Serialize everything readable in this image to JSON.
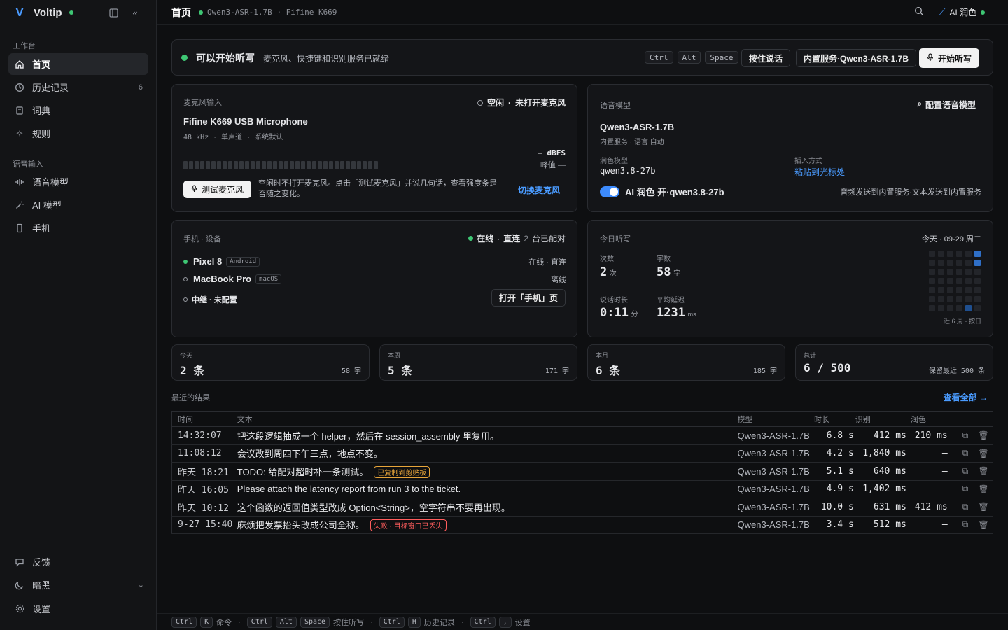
{
  "app": {
    "name": "Voltip",
    "logo": "V"
  },
  "sidebar": {
    "sections": [
      {
        "label": "工作台"
      },
      {
        "label": "语音输入"
      }
    ],
    "items": [
      {
        "label": "首页",
        "icon": "home-icon"
      },
      {
        "label": "历史记录",
        "icon": "history-icon",
        "count": "6"
      },
      {
        "label": "词典",
        "icon": "book-icon"
      },
      {
        "label": "规则",
        "icon": "sparkle-icon"
      },
      {
        "label": "语音模型",
        "icon": "waveform-icon"
      },
      {
        "label": "AI 模型",
        "icon": "wand-icon"
      },
      {
        "label": "手机",
        "icon": "phone-icon"
      }
    ],
    "bottom": [
      {
        "label": "反馈",
        "icon": "feedback-icon"
      },
      {
        "label": "暗黑",
        "icon": "moon-icon"
      },
      {
        "label": "设置",
        "icon": "gear-icon"
      }
    ]
  },
  "topbar": {
    "title": "首页",
    "subtitle": "Qwen3-ASR-1.7B · Fifine K669",
    "ai_label": "AI 润色"
  },
  "ready": {
    "title": "可以开始听写",
    "desc": "麦克风、快捷键和识别服务已就绪",
    "keys": [
      "Ctrl",
      "Alt",
      "Space"
    ],
    "mode_btn": "按住说话",
    "service_btn": "内置服务·Qwen3-ASR-1.7B",
    "start_btn": "开始听写"
  },
  "mic": {
    "label": "麦克风输入",
    "status": "空闲",
    "status2": "未打开麦克风",
    "name": "Fifine K669 USB Microphone",
    "meta": "48 kHz · 单声道 · 系统默认",
    "dbfs": "— dBFS",
    "peak": "峰值 —",
    "test_btn": "测试麦克风",
    "hint": "空闲时不打开麦克风。点击「测试麦克风」并说几句话，查看强度条是否随之变化。",
    "switch": "切换麦克风"
  },
  "asr": {
    "label": "语音模型",
    "config_btn": "配置语音模型",
    "name": "Qwen3-ASR-1.7B",
    "meta": "内置服务 · 语言 自动",
    "polish_label": "润色模型",
    "polish_value": "qwen3.8-27b",
    "insert_label": "插入方式",
    "insert_value": "粘贴到光标处",
    "toggle_label": "AI 润色 开·qwen3.8-27b",
    "note": "音频发送到内置服务·文本发送到内置服务"
  },
  "devices": {
    "label": "手机 · 设备",
    "status": "在线",
    "direct": "直连",
    "count": "2",
    "count_suffix": "台已配对",
    "list": [
      {
        "name": "Pixel 8",
        "tag": "Android",
        "state": "在线 · 直连",
        "online": true
      },
      {
        "name": "MacBook Pro",
        "tag": "macOS",
        "state": "离线",
        "online": false
      }
    ],
    "relay": "中继 · 未配置",
    "open_btn": "打开「手机」页"
  },
  "today": {
    "label": "今日听写",
    "date": "今天 · 09-29 周二",
    "times_label": "次数",
    "times": "2",
    "times_unit": "次",
    "chars_label": "字数",
    "chars": "58",
    "chars_unit": "字",
    "dur_label": "说话时长",
    "dur": "0:11",
    "dur_unit": "分",
    "lat_label": "平均延迟",
    "lat": "1231",
    "lat_unit": "ms",
    "heatmap_caption": "近 6 周 · 按日"
  },
  "stats": [
    {
      "label": "今天",
      "value": "2 条",
      "sub": "58 字"
    },
    {
      "label": "本周",
      "value": "5 条",
      "sub": "171 字"
    },
    {
      "label": "本月",
      "value": "6 条",
      "sub": "185 字"
    },
    {
      "label": "总计",
      "value": "6 / 500",
      "sub": "保留最近 500 条"
    }
  ],
  "recent": {
    "label": "最近的结果",
    "view_all": "查看全部 →",
    "columns": [
      "时间",
      "文本",
      "模型",
      "时长",
      "识别",
      "润色"
    ],
    "rows": [
      {
        "time": "14:32:07",
        "text": "把这段逻辑抽成一个 helper，然后在 session_assembly 里复用。",
        "badge": "",
        "model": "Qwen3-ASR-1.7B",
        "dur": "6.8 s",
        "asr": "412 ms",
        "polish": "210 ms"
      },
      {
        "time": "11:08:12",
        "text": "会议改到周四下午三点，地点不变。",
        "badge": "",
        "model": "Qwen3-ASR-1.7B",
        "dur": "4.2 s",
        "asr": "1,840 ms",
        "polish": "—"
      },
      {
        "time": "昨天 18:21",
        "text": "TODO: 给配对超时补一条测试。",
        "badge": "已复制到剪贴板",
        "model": "Qwen3-ASR-1.7B",
        "dur": "5.1 s",
        "asr": "640 ms",
        "polish": "—"
      },
      {
        "time": "昨天 16:05",
        "text": "Please attach the latency report from run 3 to the ticket.",
        "badge": "",
        "model": "Qwen3-ASR-1.7B",
        "dur": "4.9 s",
        "asr": "1,402 ms",
        "polish": "—"
      },
      {
        "time": "昨天 10:12",
        "text": "这个函数的返回值类型改成 Option<String>，空字符串不要再出现。",
        "badge": "",
        "model": "Qwen3-ASR-1.7B",
        "dur": "10.0 s",
        "asr": "631 ms",
        "polish": "412 ms"
      },
      {
        "time": "9-27 15:40",
        "text": "麻烦把发票抬头改成公司全称。",
        "badge_err": "失败 · 目标窗口已丢失",
        "model": "Qwen3-ASR-1.7B",
        "dur": "3.4 s",
        "asr": "512 ms",
        "polish": "—"
      }
    ]
  },
  "footer": [
    {
      "keys": [
        "Ctrl",
        "K"
      ],
      "label": "命令"
    },
    {
      "keys": [
        "Ctrl",
        "Alt",
        "Space"
      ],
      "label": "按住听写"
    },
    {
      "keys": [
        "Ctrl",
        "H"
      ],
      "label": "历史记录"
    },
    {
      "keys": [
        "Ctrl",
        ","
      ],
      "label": "设置"
    }
  ],
  "colors": {
    "accent": "#4a9bff",
    "online": "#3ec774",
    "warn": "#e8a53a",
    "error": "#ff5d5d"
  }
}
